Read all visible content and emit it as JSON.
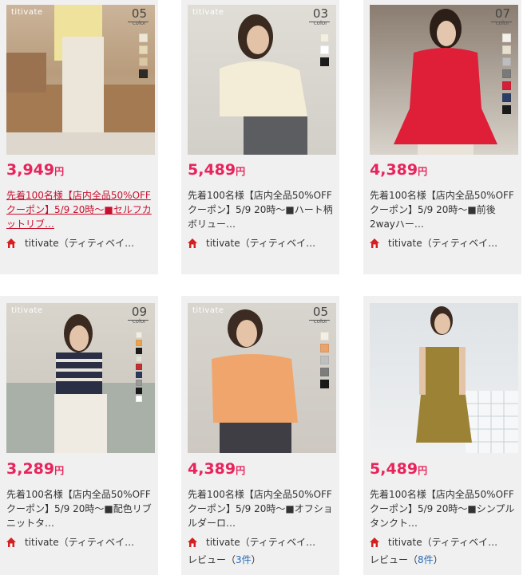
{
  "colors": {
    "price": "#e8245c",
    "visited_link": "#c8102e",
    "review_count": "#2a6ab8",
    "home_icon": "#d42020"
  },
  "products": [
    {
      "brand": "titivate",
      "color_count": "05",
      "color_label": "color",
      "price_num": "3,949",
      "price_unit": "円",
      "desc": "先着100名様【店内全品50%OFFクーポン】5/9 20時～■セルフカットリブ…",
      "shop": "titivate（ティティベイ…",
      "swatches": [
        "#ece6d6",
        "#e6d9b9",
        "#d8c7a2",
        "#2d2a27"
      ]
    },
    {
      "brand": "titivate",
      "color_count": "03",
      "color_label": "color",
      "price_num": "5,489",
      "price_unit": "円",
      "desc": "先着100名様【店内全品50%OFFクーポン】5/9 20時～■ハート柄ボリュー…",
      "shop": "titivate（ティティベイ…",
      "swatches": [
        "#f3eee2",
        "#ffffff",
        "#1c1c1c"
      ]
    },
    {
      "brand": "",
      "color_count": "07",
      "color_label": "color",
      "price_num": "4,389",
      "price_unit": "円",
      "desc": "先着100名様【店内全品50%OFFクーポン】5/9 20時～■前後2wayハー…",
      "shop": "titivate（ティティベイ…",
      "swatches": [
        "#f4f1ea",
        "#e8e0cf",
        "#bdbdbd",
        "#7a7a7a",
        "#d42038",
        "#2c3e66",
        "#1a1a1a"
      ]
    },
    {
      "brand": "titivate",
      "color_count": "09",
      "color_label": "color",
      "price_num": "3,289",
      "price_unit": "円",
      "desc": "先着100名様【店内全品50%OFFクーポン】5/9 20時～■配色リブニットタ…",
      "shop": "titivate（ティティベイ…",
      "swatches": [
        "#f2ede3",
        "#e8a44c",
        "#1c1c1c",
        "#e7e2d6",
        "#c03030",
        "#2b3a5c",
        "#9a9a9a",
        "#1a1a1a",
        "#ffffff"
      ]
    },
    {
      "brand": "titivate",
      "color_count": "05",
      "color_label": "color",
      "price_num": "4,389",
      "price_unit": "円",
      "desc": "先着100名様【店内全品50%OFFクーポン】5/9 20時～■オフショルダーロ…",
      "shop": "titivate（ティティベイ…",
      "review_label": "レビュー（",
      "review_count": "3件",
      "review_close": "）",
      "swatches": [
        "#f4efe4",
        "#e9a36b",
        "#bfbfbf",
        "#7c7c7c",
        "#1a1a1a"
      ]
    },
    {
      "brand": "",
      "color_count": "",
      "color_label": "",
      "price_num": "5,489",
      "price_unit": "円",
      "desc": "先着100名様【店内全品50%OFFクーポン】5/9 20時～■シンプルタンクト…",
      "shop": "titivate（ティティベイ…",
      "review_label": "レビュー（",
      "review_count": "8件",
      "review_close": "）",
      "swatches": []
    }
  ]
}
